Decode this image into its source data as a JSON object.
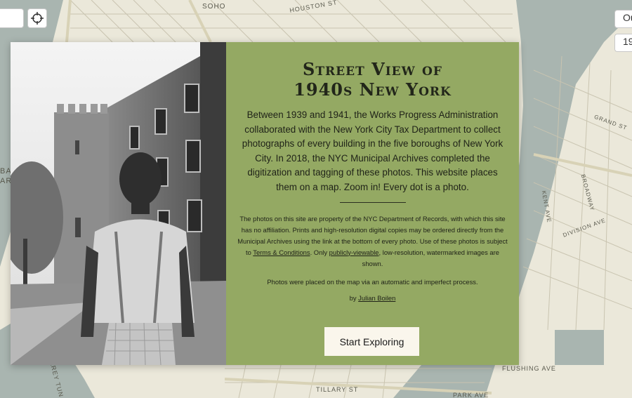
{
  "map": {
    "labels": {
      "soho": "SOHO",
      "houston": "HOUSTON ST",
      "flushing": "FLUSHING AVE",
      "tillary": "TILLARY ST",
      "park": "PARK AVE",
      "kent": "KENT AVE",
      "division": "DIVISION AVE",
      "grand": "GRAND ST",
      "broadway": "BROADWAY",
      "left_edge_1": "BA",
      "left_edge_2": "AR",
      "bottom_left": "AREY TUN"
    },
    "controls": {
      "right_top_label": "Ou",
      "right_year_label": "19"
    }
  },
  "modal": {
    "title_line1": "Street View of",
    "title_line2": "1940s New York",
    "intro": "Between 1939 and 1941, the Works Progress Administration collaborated with the New York City Tax Department to collect photographs of every building in the five boroughs of New York City. In 2018, the NYC Municipal Archives completed the digitization and tagging of these photos. This website places them on a map. Zoom in! Every dot is a photo.",
    "rights_part1": "The photos on this site are property of the NYC Department of Records, with which this site has no affiliation. Prints and high-resolution digital copies may be ordered directly from the Municipal Archives using the link at the bottom of every photo. Use of these photos is subject to ",
    "terms_link": "Terms & Conditions",
    "rights_part2": ". Only ",
    "viewable_link": "publicly-viewable",
    "rights_part3": ", low-resolution, watermarked images are shown.",
    "placed_note": "Photos were placed on the map via an automatic and imperfect process.",
    "by_prefix": "by ",
    "author_link": "Julian Boilen",
    "start_button": "Start Exploring"
  },
  "colors": {
    "modal_bg": "#94a963",
    "water": "#a9b5b0",
    "land": "#ebe8da",
    "button_bg": "#faf6ec"
  },
  "icons": {
    "locate": "crosshair-icon"
  }
}
